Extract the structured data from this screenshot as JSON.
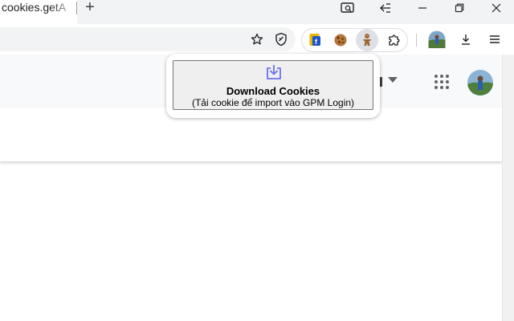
{
  "tab": {
    "title": "cookies.getAll"
  },
  "newtab_symbol": "+",
  "window_controls": [
    "search-tabs",
    "back-forward",
    "minimize",
    "restore",
    "close"
  ],
  "toolbar": {
    "icons": [
      "bookmark-star-icon",
      "shield-extension-icon",
      "facebook-extension-icon",
      "cookie-extension-icon",
      "gingerbread-extension-icon",
      "puzzle-extensions-icon",
      "profile-avatar",
      "download-icon",
      "menu-icon"
    ]
  },
  "popup": {
    "button_title": "Download Cookies",
    "button_subtitle": "(Tải cookie để import vào GPM Login)",
    "icon": "download-tray-icon",
    "icon_color": "#6b73f0"
  },
  "colors": {
    "tabstrip": "#f1f3f4",
    "accent": "#6b73f0"
  }
}
